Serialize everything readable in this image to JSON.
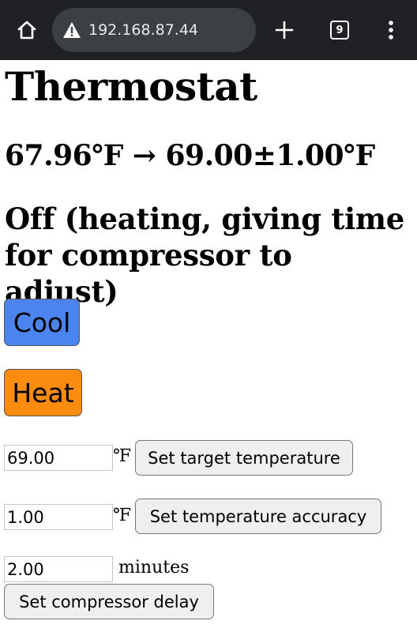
{
  "browser": {
    "url": "192.168.87.44",
    "tab_count": "9",
    "icons": {
      "home": "home-icon",
      "security": "not-secure-warning-icon",
      "new_tab": "plus-icon",
      "tabs": "tab-switcher-icon",
      "menu": "more-vert-icon"
    }
  },
  "page": {
    "title": "Thermostat",
    "temperature_line": "67.96℉ → 69.00±1.00℉",
    "status": "Off (heating, giving time for compressor to adjust)",
    "cool_label": "Cool",
    "heat_label": "Heat",
    "target": {
      "value": "69.00",
      "unit": "℉",
      "button": "Set target temperature"
    },
    "accuracy": {
      "value": "1.00",
      "unit": "℉",
      "button": "Set temperature accuracy"
    },
    "delay": {
      "value": "2.00",
      "unit": "minutes",
      "button": "Set compressor delay"
    }
  },
  "colors": {
    "browser_bar": "#202124",
    "url_pill": "#3c4043",
    "cool_button": "#4b84ef",
    "heat_button": "#fb8c10",
    "set_button": "#efefef"
  }
}
